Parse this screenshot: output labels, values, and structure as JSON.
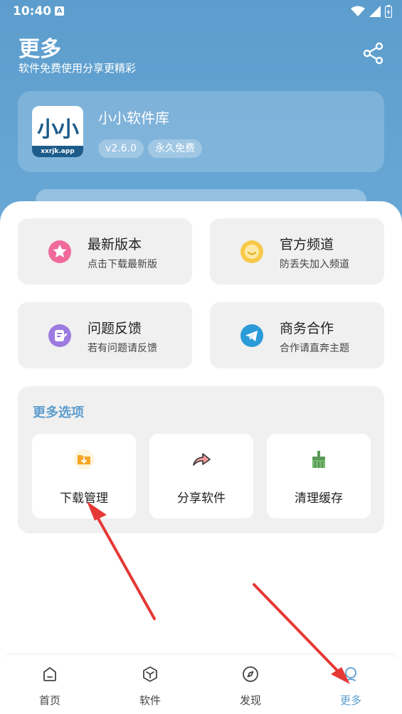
{
  "status_bar": {
    "time": "10:40",
    "notification_letter": "A"
  },
  "header": {
    "title": "更多",
    "subtitle": "软件免费使用分享更精彩"
  },
  "app_card": {
    "logo_text": "小小",
    "logo_domain": "xxrjk.app",
    "name": "小小软件库",
    "badges": [
      "v2.6.0",
      "永久免费"
    ]
  },
  "tiles": [
    {
      "title": "最新版本",
      "subtitle": "点击下载最新版",
      "icon": "star-icon",
      "color": "#f06a9a"
    },
    {
      "title": "官方频道",
      "subtitle": "防丢失加入频道",
      "icon": "smile-icon",
      "color": "#f7c948"
    },
    {
      "title": "问题反馈",
      "subtitle": "若有问题请反馈",
      "icon": "feedback-icon",
      "color": "#9b7be0"
    },
    {
      "title": "商务合作",
      "subtitle": "合作请直奔主题",
      "icon": "telegram-icon",
      "color": "#2b9bd8"
    }
  ],
  "more_options": {
    "title": "更多选项",
    "items": [
      {
        "label": "下载管理",
        "icon": "download-folder-icon"
      },
      {
        "label": "分享软件",
        "icon": "share-arrow-icon"
      },
      {
        "label": "清理缓存",
        "icon": "broom-icon"
      }
    ]
  },
  "bottom_nav": {
    "items": [
      {
        "label": "首页",
        "icon": "home-icon",
        "active": false
      },
      {
        "label": "软件",
        "icon": "cube-icon",
        "active": false
      },
      {
        "label": "发现",
        "icon": "compass-icon",
        "active": false
      },
      {
        "label": "更多",
        "icon": "more-person-icon",
        "active": true
      }
    ]
  },
  "colors": {
    "header": "#5c9dcd",
    "accent": "#5c9dcd",
    "annotation_arrow": "#e53935"
  }
}
